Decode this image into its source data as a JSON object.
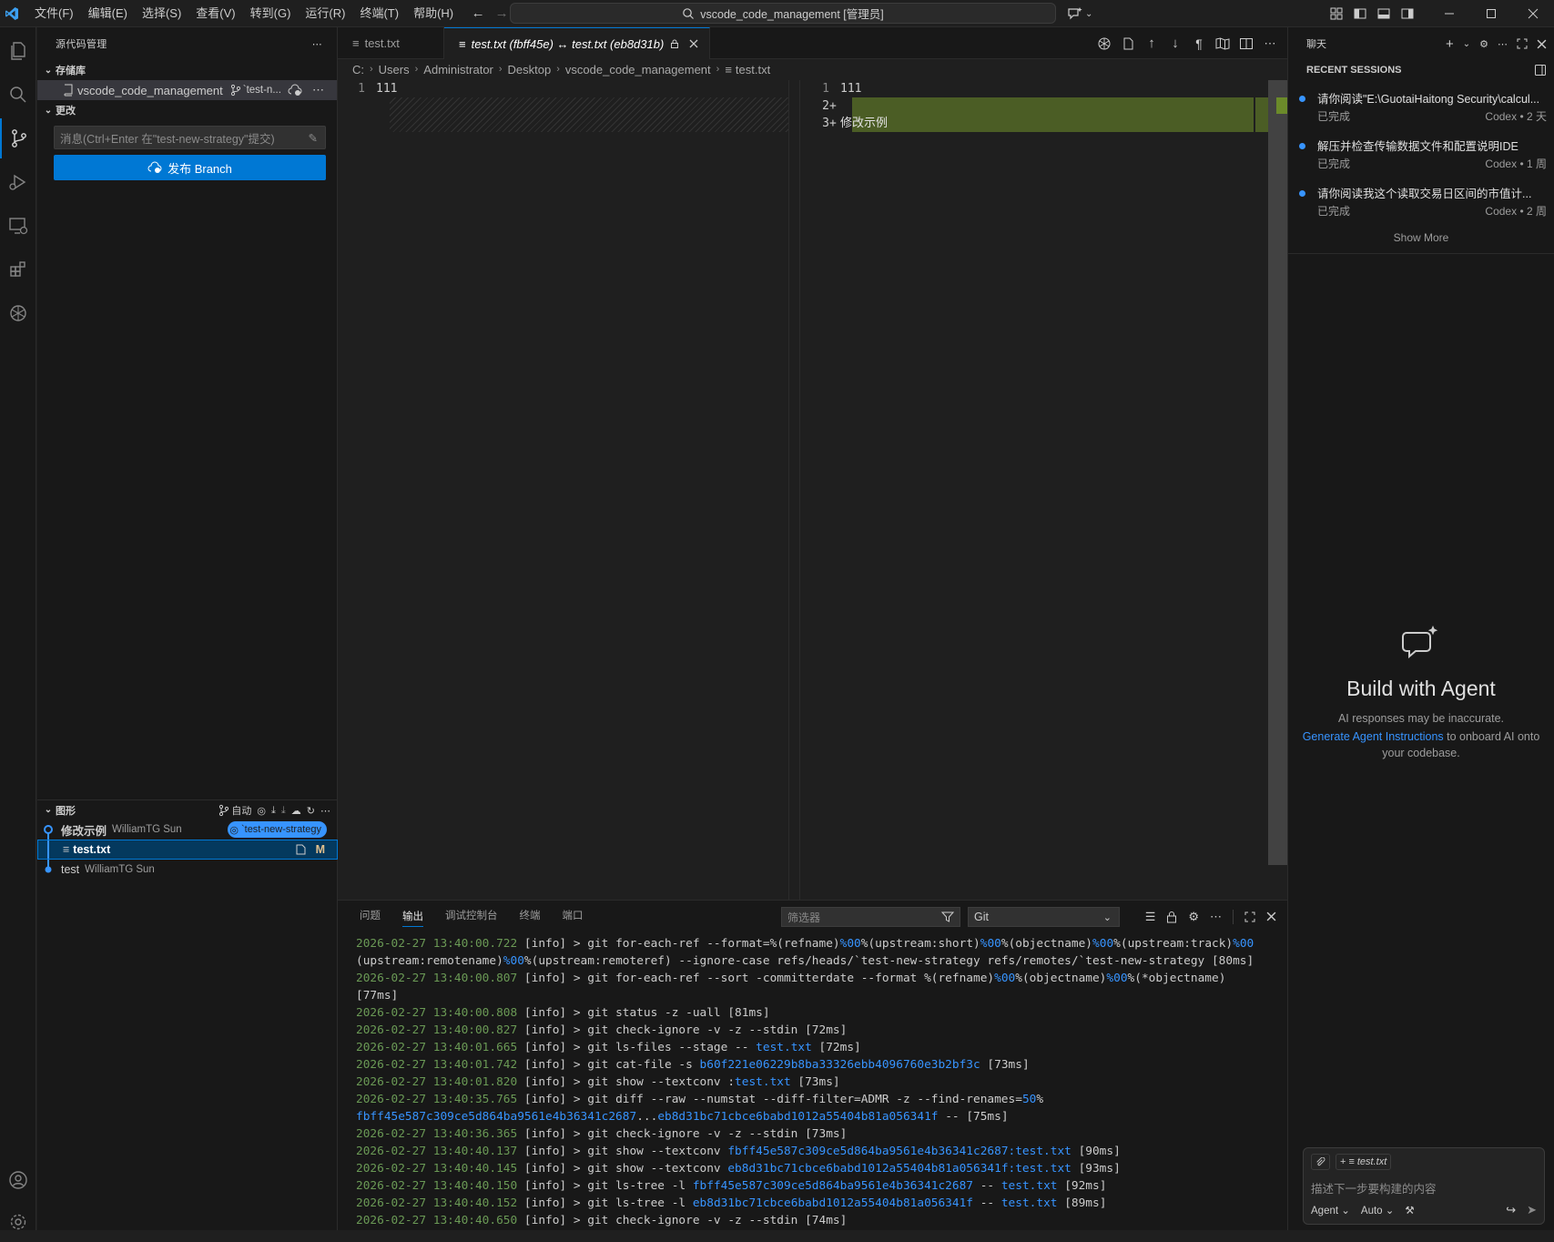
{
  "menu": [
    "文件(F)",
    "编辑(E)",
    "选择(S)",
    "查看(V)",
    "转到(G)",
    "运行(R)",
    "终端(T)",
    "帮助(H)"
  ],
  "command_center": "vscode_code_management [管理员]",
  "sidebar": {
    "title": "源代码管理",
    "repos_section": "存储库",
    "repo_name": "vscode_code_management",
    "repo_branch": "`test-n...",
    "changes_section": "更改",
    "commit_placeholder": "消息(Ctrl+Enter 在\"test-new-strategy\"提交)",
    "publish_label": "发布 Branch",
    "graph_section": "图形",
    "graph_auto": "自动",
    "graph": [
      {
        "message": "修改示例",
        "author": "WilliamTG Sun",
        "badge": "`test-new-strategy"
      },
      {
        "file": "test.txt",
        "status": "M"
      },
      {
        "message": "test",
        "author": "WilliamTG Sun"
      }
    ]
  },
  "editor": {
    "tabs": [
      {
        "label": "test.txt",
        "active": false
      },
      {
        "label": "test.txt (fbff45e) ↔ test.txt (eb8d31b)",
        "active": true
      }
    ],
    "breadcrumb": [
      "C:",
      "Users",
      "Administrator",
      "Desktop",
      "vscode_code_management",
      "test.txt"
    ],
    "left": [
      {
        "n": "1",
        "text": "111"
      }
    ],
    "right": [
      {
        "n": "1",
        "text": "111",
        "mark": ""
      },
      {
        "n": "2",
        "text": "",
        "mark": "+"
      },
      {
        "n": "3",
        "text": "修改示例",
        "mark": "+"
      }
    ]
  },
  "panel": {
    "tabs": [
      "问题",
      "输出",
      "调试控制台",
      "终端",
      "端口"
    ],
    "active_tab": "输出",
    "filter_placeholder": "筛选器",
    "channel": "Git",
    "log": [
      [
        [
          "ts",
          "2026-02-27 13:40:00.722"
        ],
        [
          "lvl",
          " [info] "
        ],
        [
          "cmd",
          "> git for-each-ref --format=%(refname)"
        ],
        [
          "hl",
          "%00"
        ],
        [
          "cmd",
          "%(upstream:short)"
        ],
        [
          "hl",
          "%00"
        ],
        [
          "cmd",
          "%(objectname)"
        ],
        [
          "hl",
          "%00"
        ],
        [
          "cmd",
          "%(upstream:track)"
        ],
        [
          "hl",
          "%00"
        ]
      ],
      [
        [
          "cmd",
          "(upstream:remotename)"
        ],
        [
          "hl",
          "%00"
        ],
        [
          "cmd",
          "%(upstream:remoteref) --ignore-case refs/heads/`test-new-strategy refs/remotes/`test-new-strategy [80ms]"
        ]
      ],
      [
        [
          "ts",
          "2026-02-27 13:40:00.807"
        ],
        [
          "lvl",
          " [info] "
        ],
        [
          "cmd",
          "> git for-each-ref --sort -committerdate --format %(refname)"
        ],
        [
          "hl",
          "%00"
        ],
        [
          "cmd",
          "%(objectname)"
        ],
        [
          "hl",
          "%00"
        ],
        [
          "cmd",
          "%(*objectname)"
        ]
      ],
      [
        [
          "cmd",
          "[77ms]"
        ]
      ],
      [
        [
          "ts",
          "2026-02-27 13:40:00.808"
        ],
        [
          "lvl",
          " [info] "
        ],
        [
          "cmd",
          "> git status -z -uall [81ms]"
        ]
      ],
      [
        [
          "ts",
          "2026-02-27 13:40:00.827"
        ],
        [
          "lvl",
          " [info] "
        ],
        [
          "cmd",
          "> git check-ignore -v -z --stdin [72ms]"
        ]
      ],
      [
        [
          "ts",
          "2026-02-27 13:40:01.665"
        ],
        [
          "lvl",
          " [info] "
        ],
        [
          "cmd",
          "> git ls-files --stage -- "
        ],
        [
          "hl",
          "test.txt"
        ],
        [
          "cmd",
          " [72ms]"
        ]
      ],
      [
        [
          "ts",
          "2026-02-27 13:40:01.742"
        ],
        [
          "lvl",
          " [info] "
        ],
        [
          "cmd",
          "> git cat-file -s "
        ],
        [
          "hl",
          "b60f221e06229b8ba33326ebb4096760e3b2bf3c"
        ],
        [
          "cmd",
          " [73ms]"
        ]
      ],
      [
        [
          "ts",
          "2026-02-27 13:40:01.820"
        ],
        [
          "lvl",
          " [info] "
        ],
        [
          "cmd",
          "> git show --textconv :"
        ],
        [
          "hl",
          "test.txt"
        ],
        [
          "cmd",
          " [73ms]"
        ]
      ],
      [
        [
          "ts",
          "2026-02-27 13:40:35.765"
        ],
        [
          "lvl",
          " [info] "
        ],
        [
          "cmd",
          "> git diff --raw --numstat --diff-filter=ADMR -z --find-renames="
        ],
        [
          "hl",
          "50"
        ],
        [
          "cmd",
          "%"
        ]
      ],
      [
        [
          "hl",
          "fbff45e587c309ce5d864ba9561e4b36341c2687"
        ],
        [
          "cmd",
          "..."
        ],
        [
          "hl",
          "eb8d31bc71cbce6babd1012a55404b81a056341f"
        ],
        [
          "cmd",
          " -- [75ms]"
        ]
      ],
      [
        [
          "ts",
          "2026-02-27 13:40:36.365"
        ],
        [
          "lvl",
          " [info] "
        ],
        [
          "cmd",
          "> git check-ignore -v -z --stdin [73ms]"
        ]
      ],
      [
        [
          "ts",
          "2026-02-27 13:40:40.137"
        ],
        [
          "lvl",
          " [info] "
        ],
        [
          "cmd",
          "> git show --textconv "
        ],
        [
          "hl",
          "fbff45e587c309ce5d864ba9561e4b36341c2687:test.txt"
        ],
        [
          "cmd",
          " [90ms]"
        ]
      ],
      [
        [
          "ts",
          "2026-02-27 13:40:40.145"
        ],
        [
          "lvl",
          " [info] "
        ],
        [
          "cmd",
          "> git show --textconv "
        ],
        [
          "hl",
          "eb8d31bc71cbce6babd1012a55404b81a056341f:test.txt"
        ],
        [
          "cmd",
          " [93ms]"
        ]
      ],
      [
        [
          "ts",
          "2026-02-27 13:40:40.150"
        ],
        [
          "lvl",
          " [info] "
        ],
        [
          "cmd",
          "> git ls-tree -l "
        ],
        [
          "hl",
          "fbff45e587c309ce5d864ba9561e4b36341c2687"
        ],
        [
          "cmd",
          " -- "
        ],
        [
          "hl",
          "test.txt"
        ],
        [
          "cmd",
          " [92ms]"
        ]
      ],
      [
        [
          "ts",
          "2026-02-27 13:40:40.152"
        ],
        [
          "lvl",
          " [info] "
        ],
        [
          "cmd",
          "> git ls-tree -l "
        ],
        [
          "hl",
          "eb8d31bc71cbce6babd1012a55404b81a056341f"
        ],
        [
          "cmd",
          " -- "
        ],
        [
          "hl",
          "test.txt"
        ],
        [
          "cmd",
          " [89ms]"
        ]
      ],
      [
        [
          "ts",
          "2026-02-27 13:40:40.650"
        ],
        [
          "lvl",
          " [info] "
        ],
        [
          "cmd",
          "> git check-ignore -v -z --stdin [74ms]"
        ]
      ]
    ]
  },
  "chat": {
    "title": "聊天",
    "sessions_title": "RECENT SESSIONS",
    "sessions": [
      {
        "title": "请你阅读\"E:\\GuotaiHaitong Security\\calcul...",
        "status": "已完成",
        "meta": "Codex • 2 天"
      },
      {
        "title": "解压并检查传输数据文件和配置说明IDE",
        "status": "已完成",
        "meta": "Codex • 1 周"
      },
      {
        "title": "请你阅读我这个读取交易日区间的市值计...",
        "status": "已完成",
        "meta": "Codex • 2 周"
      }
    ],
    "show_more": "Show More",
    "hero_title": "Build with Agent",
    "hero_sub": "AI responses may be inaccurate.",
    "hero_link": "Generate Agent Instructions",
    "hero_tail": " to onboard AI onto your codebase.",
    "input_file": "test.txt",
    "input_placeholder": "描述下一步要构建的内容",
    "mode": "Agent",
    "model": "Auto"
  }
}
